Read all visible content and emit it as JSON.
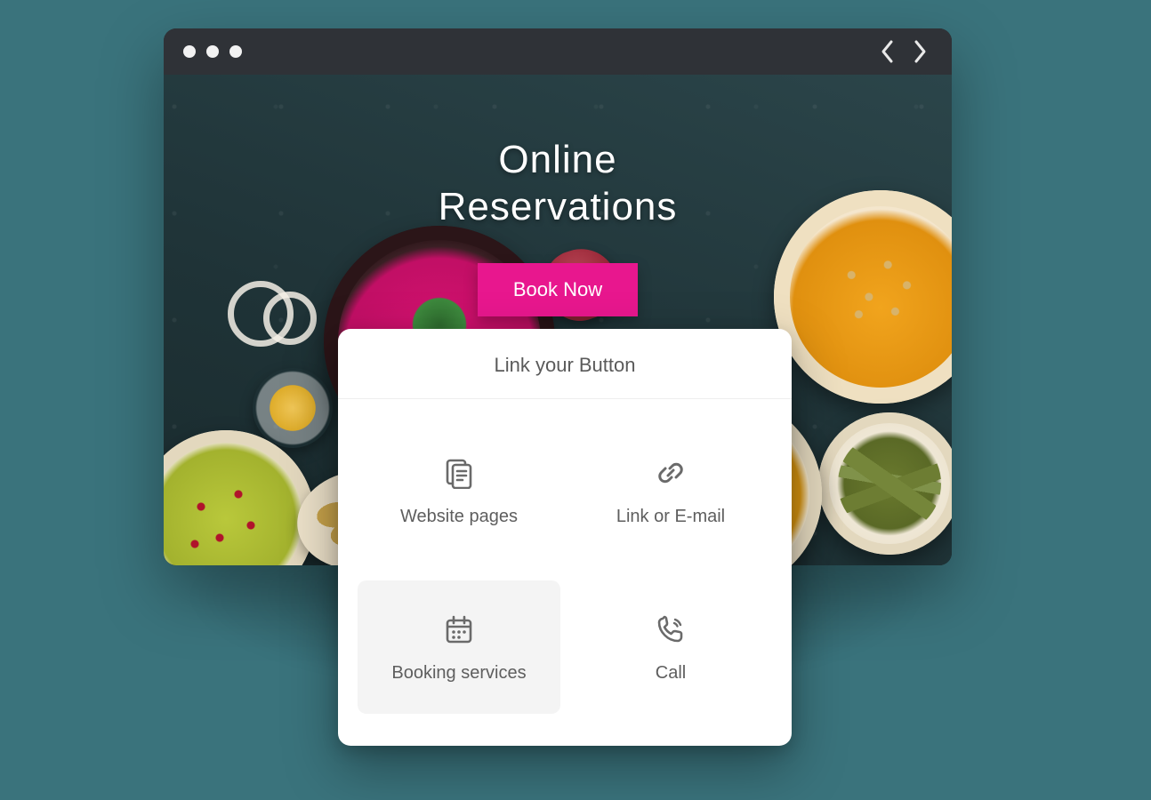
{
  "hero": {
    "title_line1": "Online",
    "title_line2": "Reservations",
    "cta_label": "Book Now"
  },
  "panel": {
    "title": "Link your Button",
    "options": [
      {
        "label": "Website pages",
        "icon": "pages-icon",
        "selected": false
      },
      {
        "label": "Link or E-mail",
        "icon": "link-icon",
        "selected": false
      },
      {
        "label": "Booking services",
        "icon": "calendar-icon",
        "selected": true
      },
      {
        "label": "Call",
        "icon": "phone-icon",
        "selected": false
      }
    ]
  },
  "colors": {
    "accent": "#e8178e",
    "page_bg": "#3a737c"
  }
}
